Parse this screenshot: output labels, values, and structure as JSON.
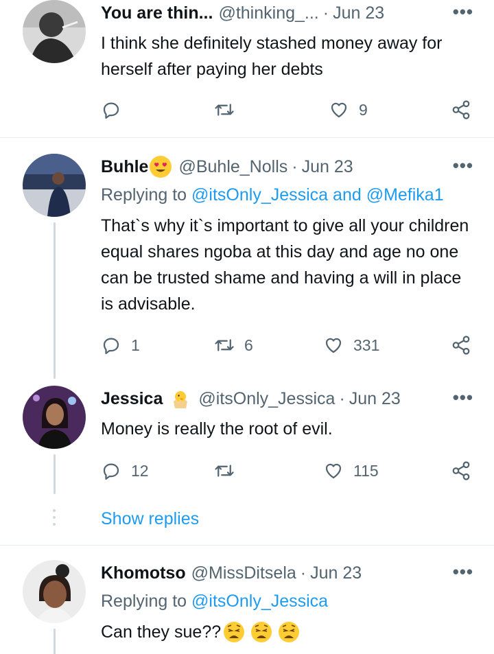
{
  "tweets": [
    {
      "name": "You are thin...",
      "handle": "@thinking_...",
      "dot": "·",
      "date": "Jun 23",
      "text": "I think she definitely stashed money away for herself after paying her debts",
      "replies": "",
      "retweets": "",
      "likes": "9"
    },
    {
      "name": "Buhle",
      "name_emoji": "heart-eyes-emoji",
      "handle": "@Buhle_Nolls",
      "dot": "·",
      "date": "Jun 23",
      "replying_prefix": "Replying to ",
      "replying_user1": "@itsOnly_Jessica",
      "replying_and": " and ",
      "replying_user2": "@Mefika1",
      "text": "That`s why it`s important to give all your children equal shares ngoba at this day and age no one can be trusted shame and having a will in place is advisable.",
      "replies": "1",
      "retweets": "6",
      "likes": "331"
    },
    {
      "name": "Jessica",
      "name_emoji": "hatching-chick-emoji",
      "handle": "@itsOnly_Jessica",
      "dot": "·",
      "date": "Jun 23",
      "text": "Money is really the root of evil.",
      "replies": "12",
      "retweets": "",
      "likes": "115"
    },
    {
      "name": "Khomotso",
      "handle": "@MissDitsela",
      "dot": "·",
      "date": "Jun 23",
      "replying_prefix": "Replying to ",
      "replying_user1": "@itsOnly_Jessica",
      "text": "Can they sue??",
      "text_emoji": [
        "weary-face-emoji",
        "weary-face-emoji",
        "weary-face-emoji"
      ]
    }
  ],
  "show_replies": "Show replies",
  "more_glyph": "•••",
  "colors": {
    "accent": "#1d9bf0",
    "secondary_text": "#536471",
    "primary_text": "#0f1419",
    "divider": "#e6ecf0",
    "thread_line": "#cfd9de"
  }
}
